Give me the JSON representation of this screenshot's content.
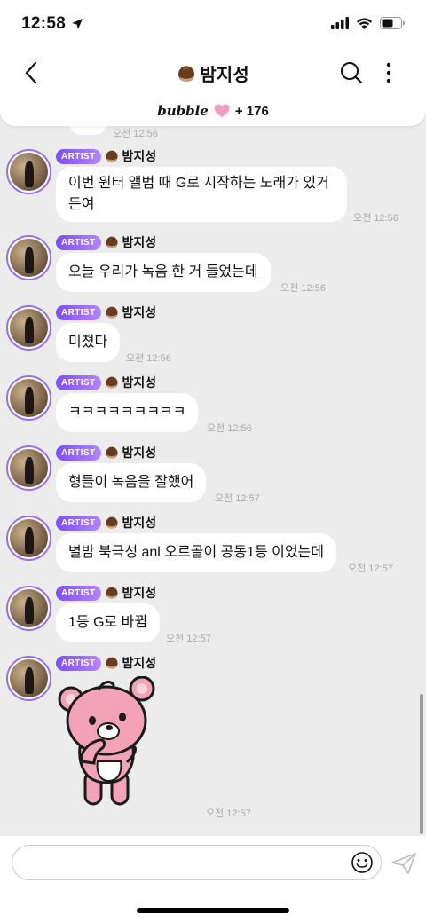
{
  "status_bar": {
    "time": "12:58",
    "icons": [
      "location-arrow-icon",
      "signal-icon",
      "wifi-icon",
      "battery-icon"
    ]
  },
  "nav": {
    "title": "밤지성",
    "title_icon": "chestnut-icon",
    "back_icon": "chevron-left-icon",
    "search_icon": "search-icon",
    "more_icon": "more-vertical-icon"
  },
  "bubble_bar": {
    "logo": "bubble",
    "icon": "heart-icon",
    "count": "+ 176"
  },
  "previous_message": {
    "time": "오전 12:56"
  },
  "messages": [
    {
      "badge": "ARTIST",
      "sender": "밤지성",
      "text": "이번 윈터 앨범 때 G로 시작하는 노래가 있거\n든여",
      "time": "오전 12:56"
    },
    {
      "badge": "ARTIST",
      "sender": "밤지성",
      "text": "오늘 우리가 녹음 한 거 들었는데",
      "time": "오전 12:56"
    },
    {
      "badge": "ARTIST",
      "sender": "밤지성",
      "text": "미쳤다",
      "time": "오전 12:56"
    },
    {
      "badge": "ARTIST",
      "sender": "밤지성",
      "text": "ㅋㅋㅋㅋㅋㅋㅋㅋㅋ",
      "time": "오전 12:56"
    },
    {
      "badge": "ARTIST",
      "sender": "밤지성",
      "text": "형들이 녹음을 잘했어",
      "time": "오전 12:57"
    },
    {
      "badge": "ARTIST",
      "sender": "밤지성",
      "text": "별밤 북극성 anl 오르골이 공동1등 이었는데",
      "time": "오전 12:57"
    },
    {
      "badge": "ARTIST",
      "sender": "밤지성",
      "text": "1등 G로 바뀜",
      "time": "오전 12:57"
    },
    {
      "badge": "ARTIST",
      "sender": "밤지성",
      "sticker": "pink-bear-thinking-sticker",
      "time": "오전 12:57"
    }
  ],
  "input": {
    "placeholder": "",
    "emoji_icon": "smiley-icon",
    "send_icon": "paper-plane-icon"
  },
  "colors": {
    "artist_badge": "#8b5cf6",
    "avatar_ring": "#9b6cf0",
    "chat_bg": "#ececec",
    "bear_pink": "#f3a3b8"
  }
}
